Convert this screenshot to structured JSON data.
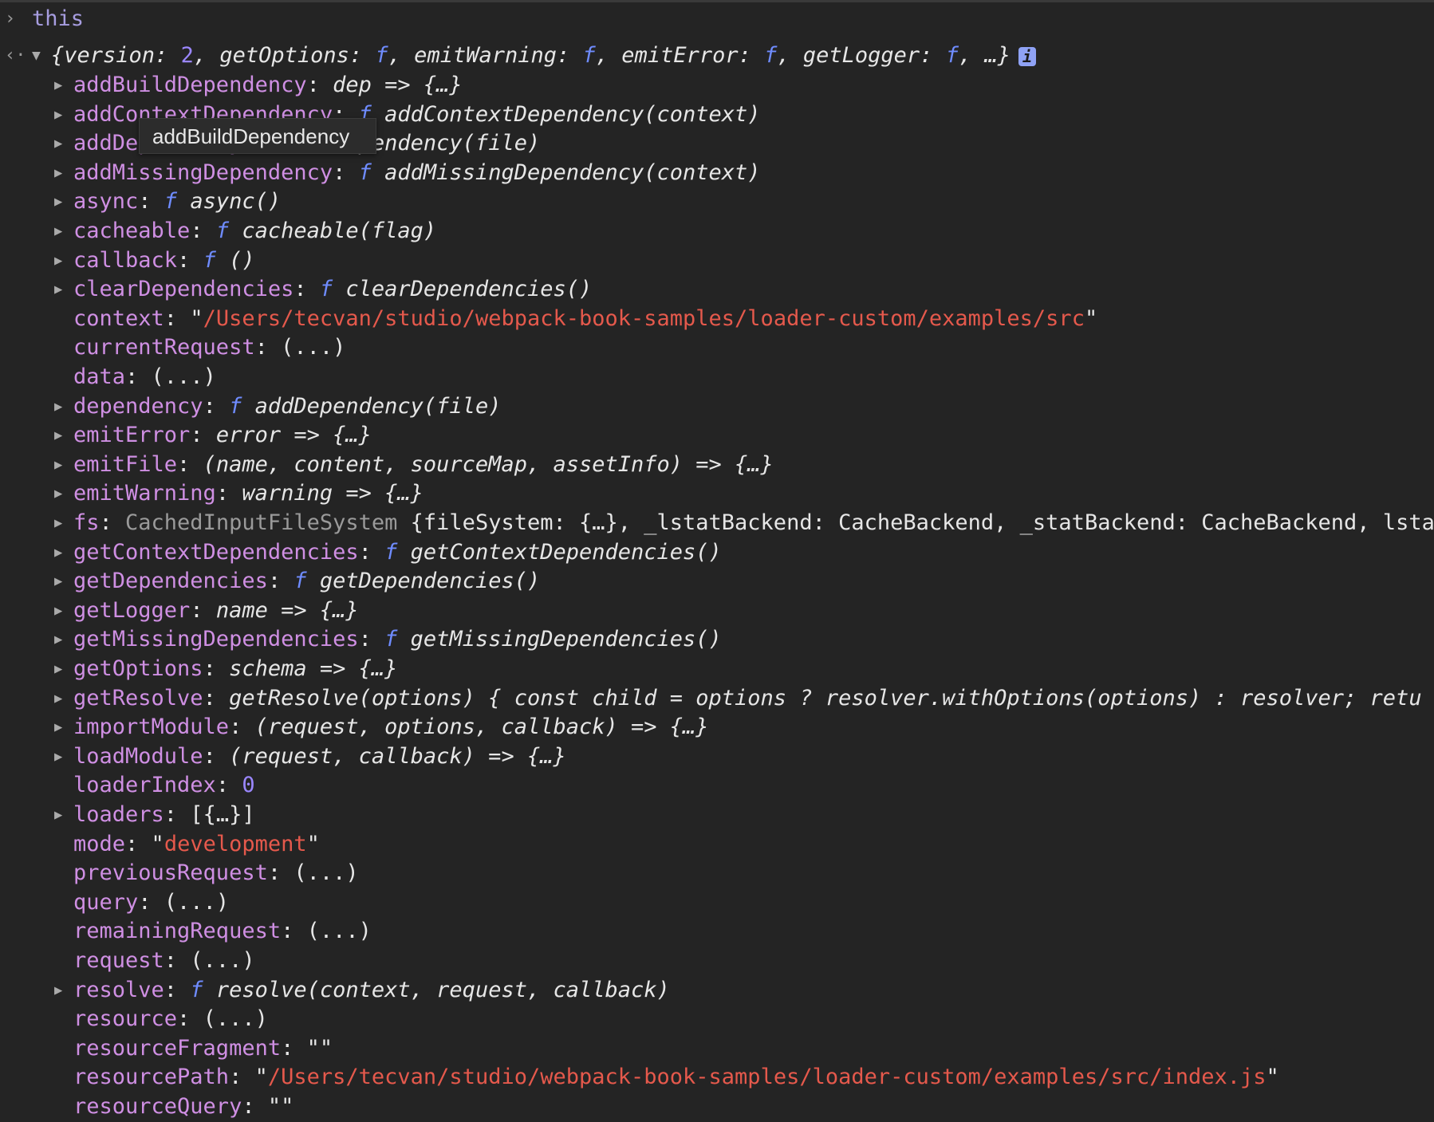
{
  "console": {
    "input_prompt": "›",
    "input": "this",
    "output_prompt": "‹·",
    "summary": [
      [
        "i",
        "{version: "
      ],
      [
        "n",
        "2"
      ],
      [
        "i",
        ", getOptions: "
      ],
      [
        "f",
        "f"
      ],
      [
        "i",
        ", emitWarning: "
      ],
      [
        "f",
        "f"
      ],
      [
        "i",
        ", emitError: "
      ],
      [
        "f",
        "f"
      ],
      [
        "i",
        ", getLogger: "
      ],
      [
        "f",
        "f"
      ],
      [
        "i",
        ", …}"
      ]
    ],
    "info_icon": "i",
    "tooltip": "addBuildDependency",
    "rows": [
      {
        "key": "addBuildDependency",
        "arrow": true,
        "val": [
          [
            "i",
            "dep => {…}"
          ]
        ]
      },
      {
        "key": "addContextDependency",
        "arrow": true,
        "val": [
          [
            "f",
            "f"
          ],
          [
            "i",
            " addContextDependency(context)"
          ]
        ]
      },
      {
        "key": "addDependency",
        "arrow": true,
        "val": [
          [
            "f",
            "f"
          ],
          [
            "i",
            " addDependency(file)"
          ]
        ]
      },
      {
        "key": "addMissingDependency",
        "arrow": true,
        "val": [
          [
            "f",
            "f"
          ],
          [
            "i",
            " addMissingDependency(context)"
          ]
        ]
      },
      {
        "key": "async",
        "arrow": true,
        "val": [
          [
            "f",
            "f"
          ],
          [
            "i",
            " async()"
          ]
        ]
      },
      {
        "key": "cacheable",
        "arrow": true,
        "val": [
          [
            "f",
            "f"
          ],
          [
            "i",
            " cacheable(flag)"
          ]
        ]
      },
      {
        "key": "callback",
        "arrow": true,
        "val": [
          [
            "f",
            "f"
          ],
          [
            "i",
            " ()"
          ]
        ]
      },
      {
        "key": "clearDependencies",
        "arrow": true,
        "val": [
          [
            "f",
            "f"
          ],
          [
            "i",
            " clearDependencies()"
          ]
        ]
      },
      {
        "key": "context",
        "arrow": false,
        "val": [
          [
            "c",
            "\""
          ],
          [
            "s",
            "/Users/tecvan/studio/webpack-book-samples/loader-custom/examples/src"
          ],
          [
            "c",
            "\""
          ]
        ]
      },
      {
        "key": "currentRequest",
        "arrow": false,
        "val": [
          [
            "c",
            "(...)"
          ]
        ]
      },
      {
        "key": "data",
        "arrow": false,
        "val": [
          [
            "c",
            "(...)"
          ]
        ]
      },
      {
        "key": "dependency",
        "arrow": true,
        "val": [
          [
            "f",
            "f"
          ],
          [
            "i",
            " addDependency(file)"
          ]
        ]
      },
      {
        "key": "emitError",
        "arrow": true,
        "val": [
          [
            "i",
            "error => {…}"
          ]
        ]
      },
      {
        "key": "emitFile",
        "arrow": true,
        "val": [
          [
            "i",
            "(name, content, sourceMap, assetInfo) => {…}"
          ]
        ]
      },
      {
        "key": "emitWarning",
        "arrow": true,
        "val": [
          [
            "i",
            "warning => {…}"
          ]
        ]
      },
      {
        "key": "fs",
        "arrow": true,
        "val": [
          [
            "g",
            "CachedInputFileSystem"
          ],
          [
            "c",
            " {fileSystem: {…}, _lstatBackend: CacheBackend, _statBackend: CacheBackend, lstat: "
          ]
        ]
      },
      {
        "key": "getContextDependencies",
        "arrow": true,
        "val": [
          [
            "f",
            "f"
          ],
          [
            "i",
            " getContextDependencies()"
          ]
        ]
      },
      {
        "key": "getDependencies",
        "arrow": true,
        "val": [
          [
            "f",
            "f"
          ],
          [
            "i",
            " getDependencies()"
          ]
        ]
      },
      {
        "key": "getLogger",
        "arrow": true,
        "val": [
          [
            "i",
            "name => {…}"
          ]
        ]
      },
      {
        "key": "getMissingDependencies",
        "arrow": true,
        "val": [
          [
            "f",
            "f"
          ],
          [
            "i",
            " getMissingDependencies()"
          ]
        ]
      },
      {
        "key": "getOptions",
        "arrow": true,
        "val": [
          [
            "i",
            "schema => {…}"
          ]
        ]
      },
      {
        "key": "getResolve",
        "arrow": true,
        "val": [
          [
            "i",
            "getResolve(options) { const child = options ? resolver.withOptions(options) : resolver; retu"
          ]
        ]
      },
      {
        "key": "importModule",
        "arrow": true,
        "val": [
          [
            "i",
            "(request, options, callback) => {…}"
          ]
        ]
      },
      {
        "key": "loadModule",
        "arrow": true,
        "val": [
          [
            "i",
            "(request, callback) => {…}"
          ]
        ]
      },
      {
        "key": "loaderIndex",
        "arrow": false,
        "val": [
          [
            "n",
            "0"
          ]
        ]
      },
      {
        "key": "loaders",
        "arrow": true,
        "val": [
          [
            "c",
            "[{…}]"
          ]
        ]
      },
      {
        "key": "mode",
        "arrow": false,
        "val": [
          [
            "c",
            "\""
          ],
          [
            "s",
            "development"
          ],
          [
            "c",
            "\""
          ]
        ]
      },
      {
        "key": "previousRequest",
        "arrow": false,
        "val": [
          [
            "c",
            "(...)"
          ]
        ]
      },
      {
        "key": "query",
        "arrow": false,
        "val": [
          [
            "c",
            "(...)"
          ]
        ]
      },
      {
        "key": "remainingRequest",
        "arrow": false,
        "val": [
          [
            "c",
            "(...)"
          ]
        ]
      },
      {
        "key": "request",
        "arrow": false,
        "val": [
          [
            "c",
            "(...)"
          ]
        ]
      },
      {
        "key": "resolve",
        "arrow": true,
        "val": [
          [
            "f",
            "f"
          ],
          [
            "i",
            " resolve(context, request, callback)"
          ]
        ]
      },
      {
        "key": "resource",
        "arrow": false,
        "val": [
          [
            "c",
            "(...)"
          ]
        ]
      },
      {
        "key": "resourceFragment",
        "arrow": false,
        "val": [
          [
            "c",
            "\"\""
          ]
        ]
      },
      {
        "key": "resourcePath",
        "arrow": false,
        "val": [
          [
            "c",
            "\""
          ],
          [
            "s",
            "/Users/tecvan/studio/webpack-book-samples/loader-custom/examples/src/index.js"
          ],
          [
            "c",
            "\""
          ]
        ]
      },
      {
        "key": "resourceQuery",
        "arrow": false,
        "val": [
          [
            "c",
            "\"\""
          ]
        ]
      }
    ]
  }
}
